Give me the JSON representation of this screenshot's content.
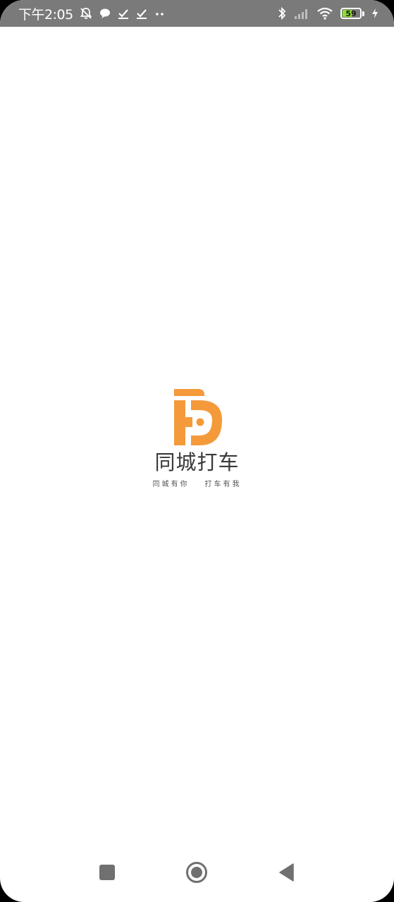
{
  "status_bar": {
    "time": "下午2:05",
    "battery_level": "59",
    "battery_percent": 59,
    "icons_left": [
      "mute-alarm-icon",
      "chat-bubble-icon",
      "check-icon",
      "check-icon",
      "more-dots-icon"
    ],
    "icons_right": [
      "bluetooth-icon",
      "signal-icon",
      "wifi-icon",
      "battery-icon",
      "charging-icon"
    ]
  },
  "splash": {
    "brand_name": "同城打车",
    "slogan_left": "同城有你",
    "slogan_right": "打车有我",
    "logo_color": "#f59a3b"
  },
  "nav_bar": {
    "buttons": [
      "recents-button",
      "home-button",
      "back-button"
    ]
  }
}
